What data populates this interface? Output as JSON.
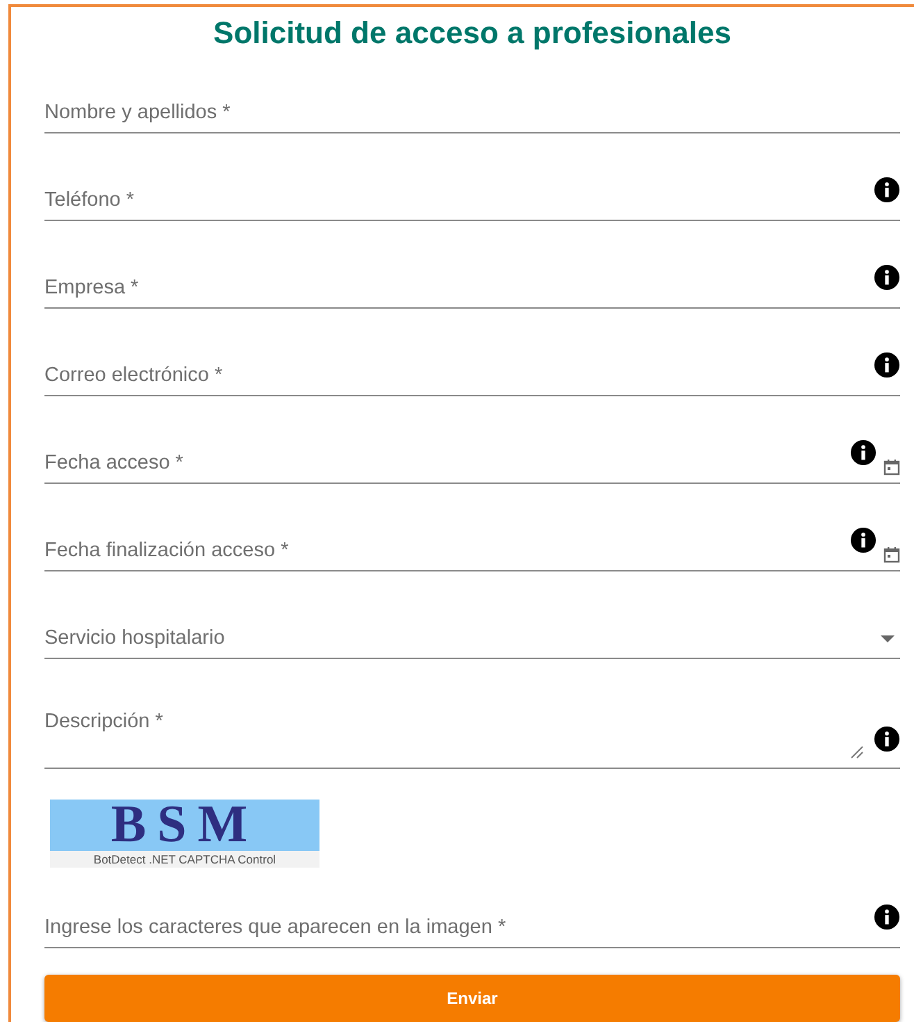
{
  "title": "Solicitud de acceso a profesionales",
  "fields": [
    {
      "label": "Nombre y apellidos *",
      "kind": "text",
      "info": false
    },
    {
      "label": "Teléfono *",
      "kind": "text",
      "info": true
    },
    {
      "label": "Empresa *",
      "kind": "text",
      "info": true
    },
    {
      "label": "Correo electrónico *",
      "kind": "text",
      "info": true
    },
    {
      "label": "Fecha acceso *",
      "kind": "date",
      "info": true
    },
    {
      "label": "Fecha finalización acceso *",
      "kind": "date",
      "info": true
    },
    {
      "label": "Servicio hospitalario",
      "kind": "select",
      "info": false
    },
    {
      "label": "Descripción *",
      "kind": "textarea",
      "info": true
    }
  ],
  "captcha": {
    "code": "BSM",
    "caption": "BotDetect .NET CAPTCHA Control"
  },
  "captcha_field": {
    "label": "Ingrese los caracteres que aparecen en la imagen *",
    "info": true
  },
  "submit": "Enviar"
}
